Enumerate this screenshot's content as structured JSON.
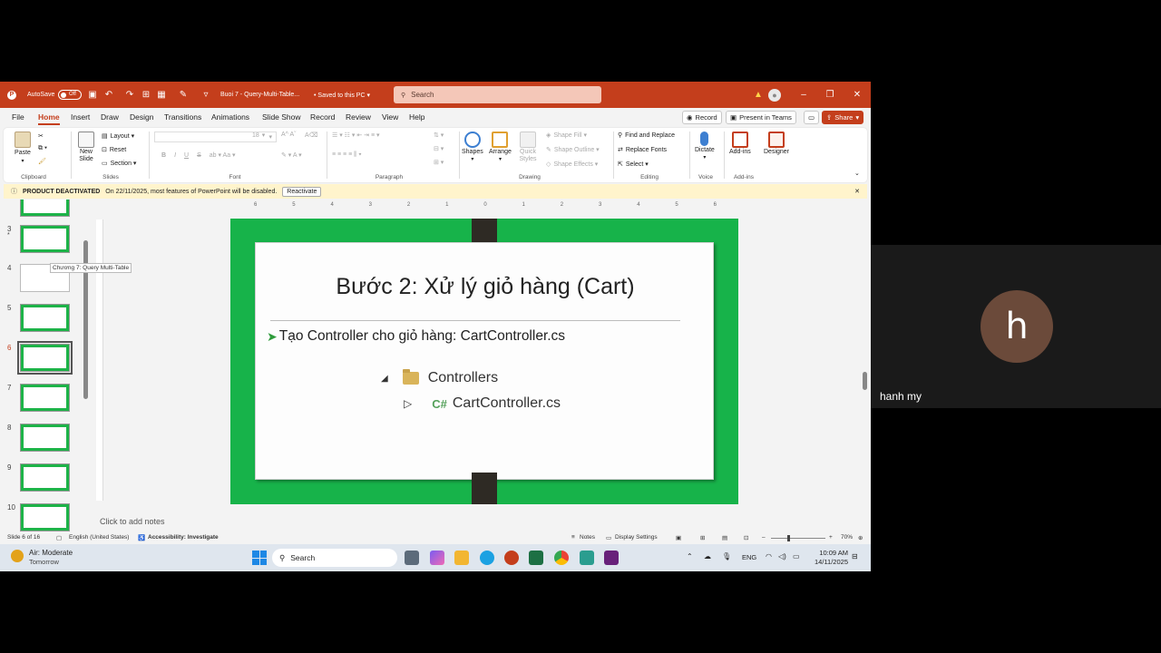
{
  "window": {
    "autosave_label": "AutoSave",
    "autosave_state": "Off",
    "doc_title": "Buoi 7 - Query-Multi-Table...",
    "saved_status": "• Saved to this PC ▾",
    "search_placeholder": "Search"
  },
  "tabs": [
    "File",
    "Home",
    "Insert",
    "Draw",
    "Design",
    "Transitions",
    "Animations",
    "Slide Show",
    "Record",
    "Review",
    "View",
    "Help"
  ],
  "top_buttons": {
    "record": "Record",
    "present": "Present in Teams",
    "share": "Share"
  },
  "ribbon": {
    "clipboard": {
      "paste": "Paste",
      "label": "Clipboard"
    },
    "slides": {
      "new_slide": "New Slide",
      "layout": "Layout ▾",
      "reset": "Reset",
      "section": "Section ▾",
      "label": "Slides"
    },
    "font": {
      "size": "18",
      "label": "Font"
    },
    "paragraph": {
      "label": "Paragraph"
    },
    "drawing": {
      "shapes": "Shapes",
      "arrange": "Arrange",
      "quick_styles": "Quick Styles",
      "shape_fill": "Shape Fill ▾",
      "shape_outline": "Shape Outline ▾",
      "shape_effects": "Shape Effects ▾",
      "label": "Drawing"
    },
    "editing": {
      "find_replace": "Find and Replace",
      "replace_fonts": "Replace Fonts",
      "select": "Select ▾",
      "label": "Editing"
    },
    "voice": {
      "dictate": "Dictate",
      "label": "Voice"
    },
    "addins": {
      "addins": "Add-ins",
      "designer": "Designer",
      "label": "Add-ins"
    }
  },
  "notice": {
    "title": "PRODUCT DEACTIVATED",
    "message": "On 22/11/2025, most features of PowerPoint will be disabled.",
    "button": "Reactivate"
  },
  "thumbnails": {
    "numbers": [
      "3",
      "4",
      "5",
      "6",
      "7",
      "8",
      "9",
      "10"
    ],
    "selected": "6",
    "tooltip": "Chương 7: Query Multi-Table"
  },
  "ruler": [
    "6",
    "5",
    "4",
    "3",
    "2",
    "1",
    "0",
    "1",
    "2",
    "3",
    "4",
    "5",
    "6"
  ],
  "slide": {
    "title": "Bước 2: Xử lý giỏ hàng (Cart)",
    "bullet": "Tạo Controller cho giỏ hàng: CartController.cs",
    "tree_folder": "Controllers",
    "tree_file_badge": "C#",
    "tree_file": "CartController.cs"
  },
  "notes_placeholder": "Click to add notes",
  "status": {
    "slide_pos": "Slide 6 of 16",
    "language": "English (United States)",
    "accessibility": "Accessibility: Investigate",
    "notes": "Notes",
    "display": "Display Settings",
    "zoom": "70%"
  },
  "taskbar": {
    "weather_title": "Air: Moderate",
    "weather_sub": "Tomorrow",
    "search": "Search",
    "lang": "ENG",
    "time": "10:09 AM",
    "date": "14/11/2025"
  },
  "participant": {
    "initial": "h",
    "name": "hanh my"
  },
  "colors": {
    "accent": "#c43e1c",
    "slide_green": "#17b34a",
    "avatar": "#6b4a3a"
  }
}
